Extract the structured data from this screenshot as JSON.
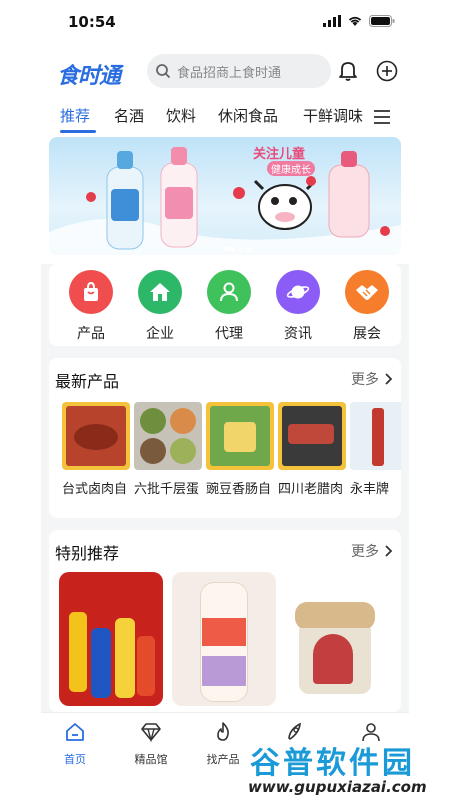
{
  "status": {
    "time": "10:54"
  },
  "header": {
    "logo": "食时通",
    "search_placeholder": "食品招商上食时通"
  },
  "tabs": [
    "推荐",
    "名酒",
    "饮料",
    "休闲食品",
    "干鲜调味"
  ],
  "banner": {
    "text_top": "关注儿童",
    "text_sub": "健康成长"
  },
  "categories": [
    {
      "label": "产品",
      "color": "#f04e4e",
      "icon": "shopping-bag-icon"
    },
    {
      "label": "企业",
      "color": "#2cb868",
      "icon": "home-icon"
    },
    {
      "label": "代理",
      "color": "#3fc15c",
      "icon": "person-icon"
    },
    {
      "label": "资讯",
      "color": "#8b5cf6",
      "icon": "planet-icon"
    },
    {
      "label": "展会",
      "color": "#f57d2c",
      "icon": "handshake-icon"
    }
  ],
  "latest": {
    "title": "最新产品",
    "more": "更多",
    "items": [
      "台式卤肉自",
      "六批千层蛋",
      "豌豆香肠自",
      "四川老腊肉",
      "永丰牌"
    ]
  },
  "featured": {
    "title": "特别推荐",
    "more": "更多"
  },
  "tabbar": {
    "items": [
      {
        "label": "首页",
        "icon": "home-icon"
      },
      {
        "label": "精品馆",
        "icon": "diamond-icon"
      },
      {
        "label": "找产品",
        "icon": "flame-icon"
      },
      {
        "label": "",
        "icon": "rocket-icon"
      },
      {
        "label": "",
        "icon": "user-icon"
      }
    ]
  },
  "watermark": {
    "title": "谷普软件园",
    "url": "www.gupuxiazai.com"
  },
  "colors": {
    "accent": "#2a6de0",
    "background": "#f4f5f7"
  }
}
